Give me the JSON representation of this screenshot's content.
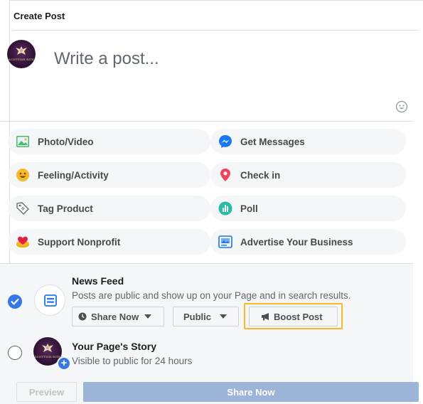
{
  "header": {
    "title": "Create Post"
  },
  "composer": {
    "placeholder": "Write a post...",
    "avatar_text": "SCOTTISH RITE"
  },
  "actions": [
    {
      "id": "photo-video",
      "label": "Photo/Video",
      "icon": "photo-icon"
    },
    {
      "id": "get-messages",
      "label": "Get Messages",
      "icon": "messenger-icon"
    },
    {
      "id": "feeling-activity",
      "label": "Feeling/Activity",
      "icon": "smiley-icon"
    },
    {
      "id": "check-in",
      "label": "Check in",
      "icon": "location-pin-icon"
    },
    {
      "id": "tag-product",
      "label": "Tag Product",
      "icon": "price-tag-icon"
    },
    {
      "id": "poll",
      "label": "Poll",
      "icon": "poll-icon"
    },
    {
      "id": "support-nonprofit",
      "label": "Support Nonprofit",
      "icon": "heart-coin-icon"
    },
    {
      "id": "advertise-business",
      "label": "Advertise Your Business",
      "icon": "advertise-icon"
    }
  ],
  "news_feed": {
    "title": "News Feed",
    "description": "Posts are public and show up on your Page and in search results.",
    "checked": true,
    "share_now_label": "Share Now",
    "audience_label": "Public",
    "boost_label": "Boost Post"
  },
  "story": {
    "title": "Your Page's Story",
    "description": "Visible to public for 24 hours",
    "checked": false
  },
  "footer": {
    "preview_label": "Preview",
    "share_label": "Share Now"
  },
  "colors": {
    "accent": "#3578e5",
    "boost_highlight": "#f7b928",
    "share_disabled": "#9cb4d8"
  }
}
